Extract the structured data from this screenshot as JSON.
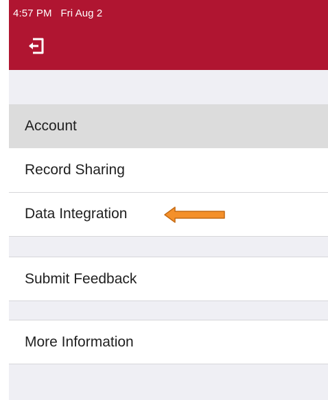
{
  "status_bar": {
    "time": "4:57 PM",
    "date": "Fri Aug 2"
  },
  "header": {
    "background_color": "#b01531",
    "logout_icon": "logout-door-icon"
  },
  "menu": {
    "section_header": "Account",
    "items": [
      {
        "label": "Record Sharing"
      },
      {
        "label": "Data Integration"
      },
      {
        "label": "Submit Feedback"
      },
      {
        "label": "More Information"
      }
    ]
  },
  "annotation": {
    "arrow_color": "#f4902a",
    "arrow_direction": "left"
  }
}
